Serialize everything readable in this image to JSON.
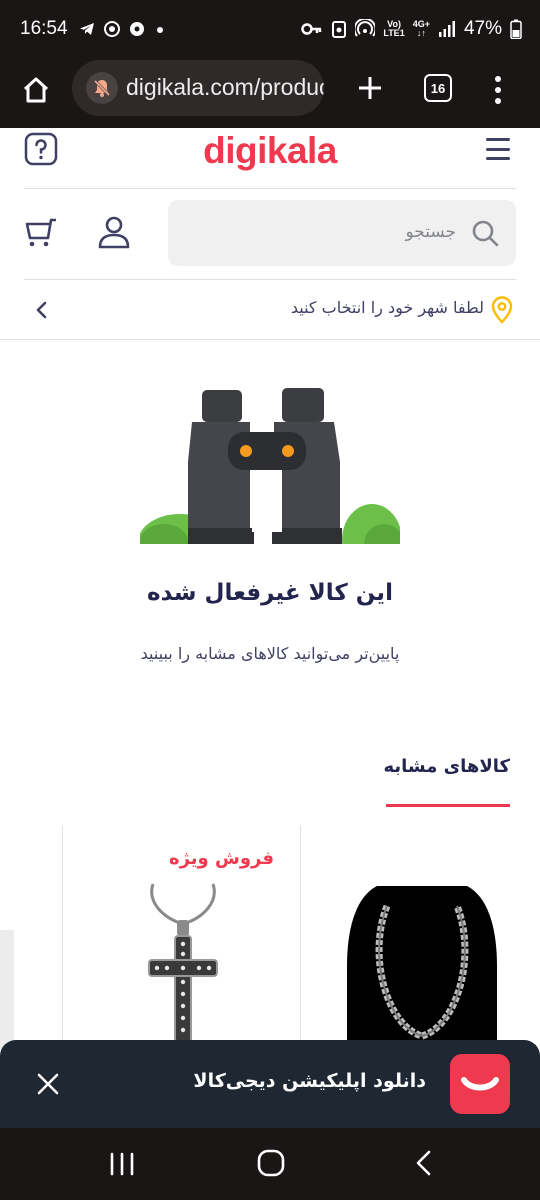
{
  "status_bar": {
    "time": "16:54",
    "network_top": "Vo)",
    "network_bottom": "LTE1",
    "signal_top": "4G+",
    "battery_percent": "47%"
  },
  "browser": {
    "url": "digikala.com/product/",
    "tab_count": "16"
  },
  "header": {
    "logo_text": "digikala"
  },
  "search": {
    "placeholder": "جستجو"
  },
  "location": {
    "prompt": "لطفا شهر خود را انتخاب کنید"
  },
  "empty_state": {
    "title": "این کالا غیرفعال شده",
    "description": "پایین‌تر می‌توانید کالاهای مشابه را ببینید"
  },
  "similar": {
    "section_title": "کالاهای مشابه",
    "products": [
      {
        "image": "chain-necklace-image"
      },
      {
        "badge": "فروش ویژه",
        "image": "cross-pendant-image"
      }
    ]
  },
  "app_banner": {
    "text": "دانلود اپلیکیشن دیجی‌کالا"
  },
  "colors": {
    "brand": "#ef394e",
    "dark_text": "#23254e",
    "banner_bg": "#1f2733"
  }
}
